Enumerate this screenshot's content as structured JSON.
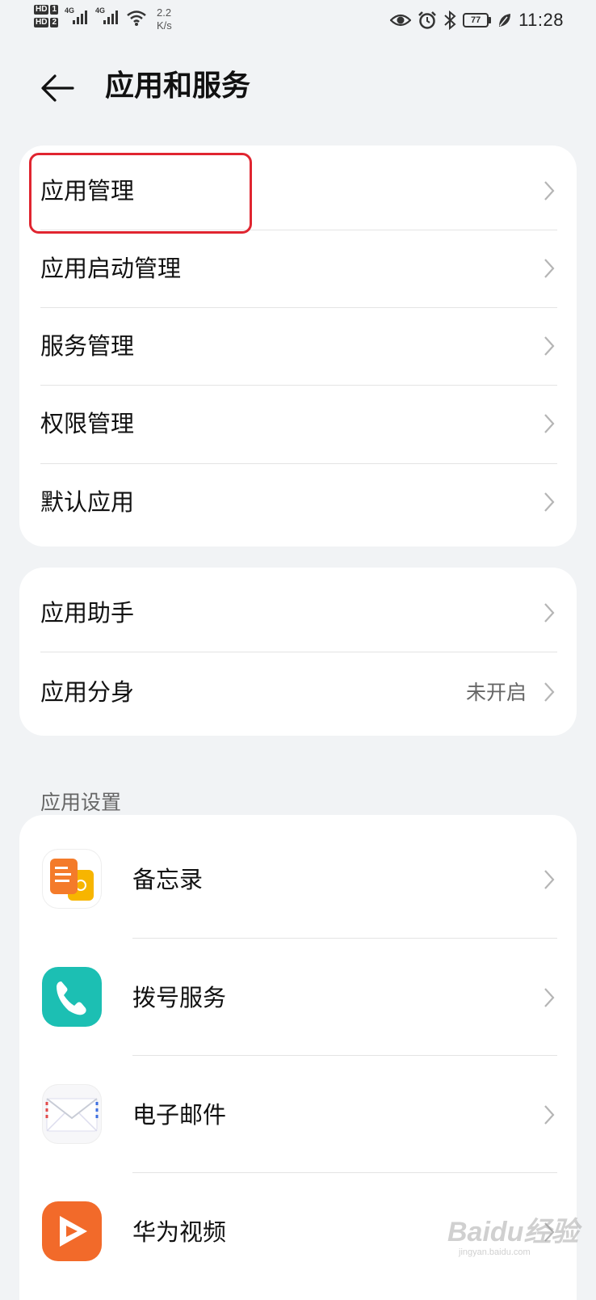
{
  "status_bar": {
    "sim1_label": "HD",
    "sim1_num": "1",
    "sim2_label": "HD",
    "sim2_num": "2",
    "network1": "4G",
    "network2": "4G",
    "speed_value": "2.2",
    "speed_unit": "K/s",
    "battery": "77",
    "time": "11:28"
  },
  "header": {
    "title": "应用和服务"
  },
  "group1": {
    "items": [
      {
        "label": "应用管理"
      },
      {
        "label": "应用启动管理"
      },
      {
        "label": "服务管理"
      },
      {
        "label": "权限管理"
      },
      {
        "label": "默认应用"
      }
    ]
  },
  "group2": {
    "items": [
      {
        "label": "应用助手",
        "value": ""
      },
      {
        "label": "应用分身",
        "value": "未开启"
      }
    ]
  },
  "app_settings": {
    "section_title": "应用设置",
    "apps": [
      {
        "label": "备忘录",
        "icon": "notepad-icon"
      },
      {
        "label": "拨号服务",
        "icon": "phone-icon"
      },
      {
        "label": "电子邮件",
        "icon": "email-icon"
      },
      {
        "label": "华为视频",
        "icon": "video-icon"
      }
    ]
  },
  "watermark": {
    "brand": "Baidu经验",
    "sub": "jingyan.baidu.com"
  },
  "colors": {
    "background": "#f1f3f5",
    "card": "#ffffff",
    "highlight": "#e02530",
    "phone_icon": "#1cbfb3",
    "video_icon": "#f26a2a",
    "notepad_icon": "#f5a623"
  }
}
